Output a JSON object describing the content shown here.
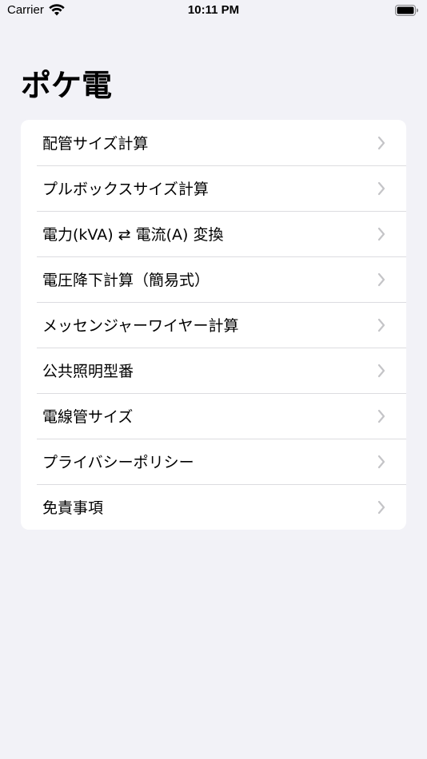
{
  "status_bar": {
    "carrier": "Carrier",
    "time": "10:11 PM"
  },
  "page": {
    "title": "ポケ電"
  },
  "menu": {
    "items": [
      {
        "label": "配管サイズ計算"
      },
      {
        "label": "プルボックスサイズ計算"
      },
      {
        "label": "電力(kVA) ⇄ 電流(A) 変換"
      },
      {
        "label": "電圧降下計算（簡易式）"
      },
      {
        "label": "メッセンジャーワイヤー計算"
      },
      {
        "label": "公共照明型番"
      },
      {
        "label": "電線管サイズ"
      },
      {
        "label": "プライバシーポリシー"
      },
      {
        "label": "免責事項"
      }
    ]
  },
  "colors": {
    "background": "#f2f2f7",
    "card": "#ffffff",
    "separator": "#dcdce0",
    "chevron": "#c4c4c7"
  },
  "icons": [
    "wifi-icon",
    "battery-icon",
    "chevron-right-icon"
  ]
}
